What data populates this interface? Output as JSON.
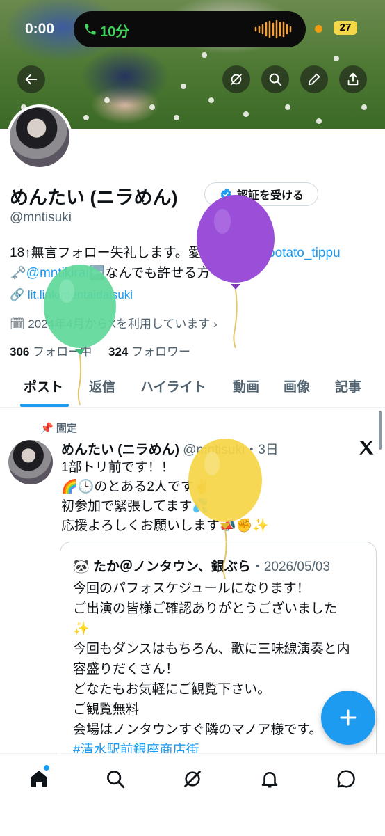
{
  "status_bar": {
    "time": "0:00",
    "call_duration": "10分",
    "battery": "27"
  },
  "profile": {
    "display_name": "めんたい (ニラめん)",
    "handle": "@mntisuki",
    "verify_label": "認証を受ける",
    "bio_line1_text": "18↑無言フォロー失礼します。愛しの相方",
    "bio_line1_mention": "@potato_tippu",
    "bio_line2_mention": "@mntikirai",
    "bio_line2_text": "なんでも許せる方",
    "link": "lit.link/mentaidaisuki",
    "joined": "2024年4月からXを利用しています",
    "following_count": "306",
    "following_label": "フォロー中",
    "followers_count": "324",
    "followers_label": "フォロワー"
  },
  "tabs": [
    "ポスト",
    "返信",
    "ハイライト",
    "動画",
    "画像",
    "記事"
  ],
  "pinned_post": {
    "pinned_label": "固定",
    "author_name": "めんたい (ニラめん)",
    "author_handle": "@mntisuki",
    "time": "・3日",
    "lines": [
      "1部トリ前です！！",
      "のとある2人です",
      "初参加で緊張してます",
      "応援よろしくお願いします"
    ],
    "quote": {
      "author": "たか＠ノンタウン、銀ぶら",
      "date": "・2026/05/03",
      "lines": [
        "今回のパフォスケジュールになります！",
        "ご出演の皆様ご確認ありがとうございました",
        "今回もダンスはもちろん、歌に三味線演奏と内",
        "容盛りだくさん！",
        "どなたもお気軽にご観覧下さい。",
        "ご観覧無料",
        "会場はノンタウンすぐ隣のマノア様です。"
      ],
      "hashtag": "#清水駅前銀座商店街"
    }
  },
  "colors": {
    "accent": "#1d9bf0",
    "balloon_purple": "#9b4fd9",
    "balloon_green": "#5fd89a",
    "balloon_yellow": "#f5d547"
  }
}
